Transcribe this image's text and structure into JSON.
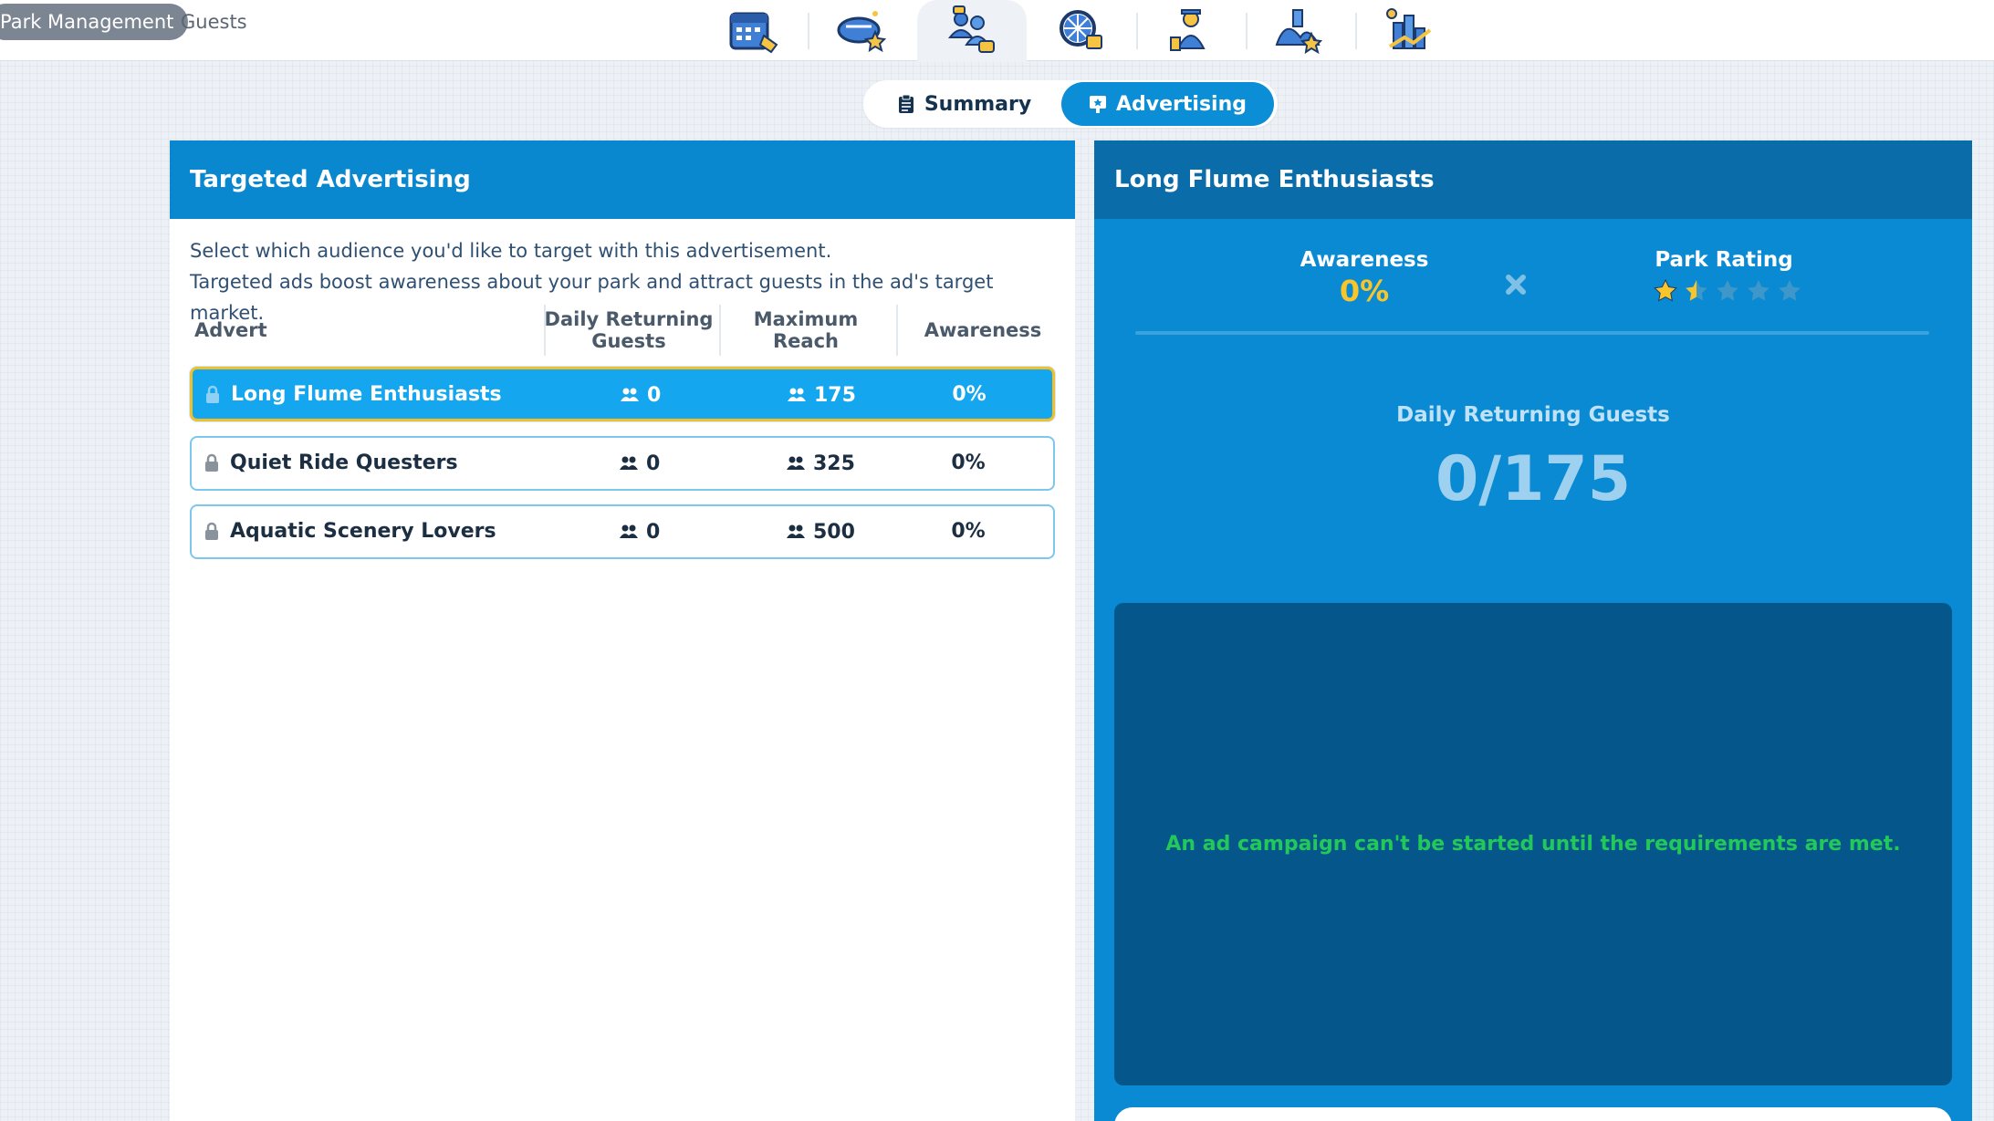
{
  "breadcrumb": {
    "parent": "Park Management",
    "current": "Guests"
  },
  "nav_icons": [
    "calendar-icon",
    "guests-rating-icon",
    "guest-advertising-icon",
    "rides-icon",
    "staff-icon",
    "scenery-icon",
    "finance-chart-icon"
  ],
  "tabs": {
    "summary": "Summary",
    "advertising": "Advertising",
    "active": "advertising"
  },
  "left": {
    "title": "Targeted Advertising",
    "desc_line1": "Select which audience you'd like to target with this advertisement.",
    "desc_line2": "Targeted ads boost awareness about your park and attract guests in the ad's target market.",
    "columns": {
      "advert": "Advert",
      "daily_line1": "Daily Returning",
      "daily_line2": "Guests",
      "reach": "Maximum Reach",
      "awareness": "Awareness"
    },
    "rows": [
      {
        "name": "Long Flume Enthusiasts",
        "daily": "0",
        "reach": "175",
        "awareness": "0%",
        "selected": true
      },
      {
        "name": "Quiet Ride Questers",
        "daily": "0",
        "reach": "325",
        "awareness": "0%",
        "selected": false
      },
      {
        "name": "Aquatic Scenery Lovers",
        "daily": "0",
        "reach": "500",
        "awareness": "0%",
        "selected": false
      }
    ]
  },
  "right": {
    "title": "Long Flume Enthusiasts",
    "awareness_label": "Awareness",
    "awareness_value": "0%",
    "rating_label": "Park Rating",
    "rating_stars": 1.5,
    "rating_max": 5,
    "daily_label": "Daily Returning Guests",
    "daily_value": "0/175",
    "requirements_msg": "An ad campaign can't be started until the requirements are met."
  },
  "colors": {
    "accent": "#0c8ed6",
    "header": "#0a88cf",
    "selected_border": "#f0bf2a",
    "awareness": "#f8c52b",
    "ok_text": "#22c95a"
  }
}
